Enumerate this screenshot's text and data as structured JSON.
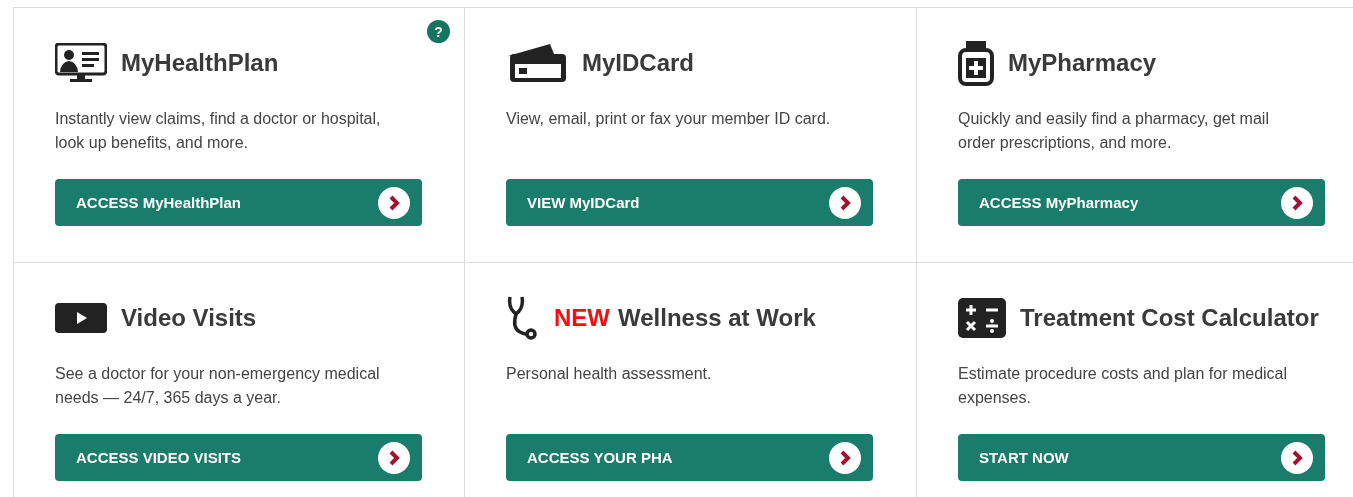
{
  "cards": [
    {
      "title": "MyHealthPlan",
      "help": "?",
      "description": "Instantly view claims, find a doctor or hospital, look up benefits, and more.",
      "button": "ACCESS MyHealthPlan"
    },
    {
      "title": "MyIDCard",
      "description": "View, email, print or fax your member ID card.",
      "button": "VIEW MyIDCard"
    },
    {
      "title": "MyPharmacy",
      "description": "Quickly and easily find a pharmacy, get mail order prescriptions, and more.",
      "button": "ACCESS MyPharmacy"
    },
    {
      "title": "Video Visits",
      "description": "See a doctor for your non-emergency medical needs — 24/7, 365 days a year.",
      "button": "ACCESS VIDEO VISITS"
    },
    {
      "title": "Wellness at Work",
      "badge": "NEW",
      "description": "Personal health assessment.",
      "button": "ACCESS YOUR PHA"
    },
    {
      "title": "Treatment Cost Calculator",
      "description": "Estimate procedure costs and plan for medical expenses.",
      "button": "START NOW"
    }
  ]
}
